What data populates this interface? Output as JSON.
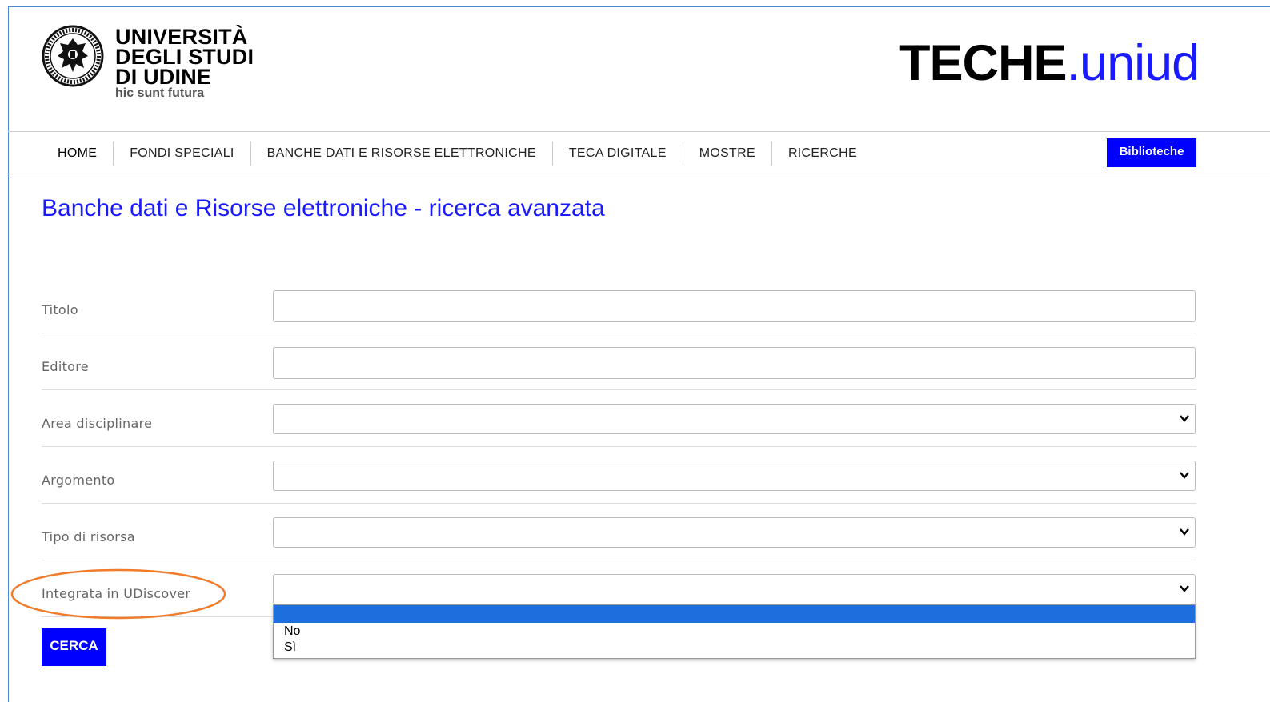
{
  "header": {
    "logo_lines": [
      "UNIVERSITÀ",
      "DEGLI STUDI",
      "DI UDINE"
    ],
    "logo_motto": "hic sunt futura",
    "brand_part1": "TECHE",
    "brand_part2": ".uniud"
  },
  "nav": {
    "items": [
      {
        "label": "HOME"
      },
      {
        "label": "FONDI SPECIALI"
      },
      {
        "label": "BANCHE DATI E RISORSE ELETTRONICHE"
      },
      {
        "label": "TECA DIGITALE"
      },
      {
        "label": "MOSTRE"
      },
      {
        "label": "RICERCHE"
      }
    ],
    "biblioteche_label": "Biblioteche"
  },
  "page_title": "Banche dati e Risorse elettroniche - ricerca avanzata",
  "form": {
    "fields": [
      {
        "label": "Titolo",
        "type": "text",
        "value": ""
      },
      {
        "label": "Editore",
        "type": "text",
        "value": ""
      },
      {
        "label": "Area disciplinare",
        "type": "select",
        "value": ""
      },
      {
        "label": "Argomento",
        "type": "select",
        "value": ""
      },
      {
        "label": "Tipo di risorsa",
        "type": "select",
        "value": ""
      },
      {
        "label": "Integrata in UDiscover",
        "type": "select",
        "value": ""
      }
    ],
    "submit_label": "CERCA",
    "open_dropdown_options": [
      "",
      "No",
      "Sì"
    ]
  },
  "colors": {
    "accent_blue": "#0000ff",
    "title_blue": "#1a1aff",
    "selected_option": "#1e6fde",
    "annotation_orange": "#f07b2a"
  }
}
